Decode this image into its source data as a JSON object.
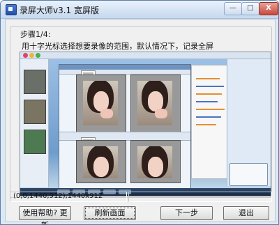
{
  "window": {
    "title": "录屏大师v3.1 宽屏版",
    "controls": {
      "minimize": "—",
      "maximize": "□",
      "close": "X"
    }
  },
  "step": {
    "label": "步骤1/4:",
    "instruction": "用十字光标选择想要录像的范围，默认情况下，记录全屏"
  },
  "status": {
    "region": "(0,0,1440,912),1440x912",
    "extra": ""
  },
  "buttons": {
    "help": "使用帮助? 更新",
    "refresh": "刷新画面",
    "next": "下一步",
    "exit": "退出"
  },
  "icons": [
    "app-icon",
    "screenshot-preview"
  ]
}
